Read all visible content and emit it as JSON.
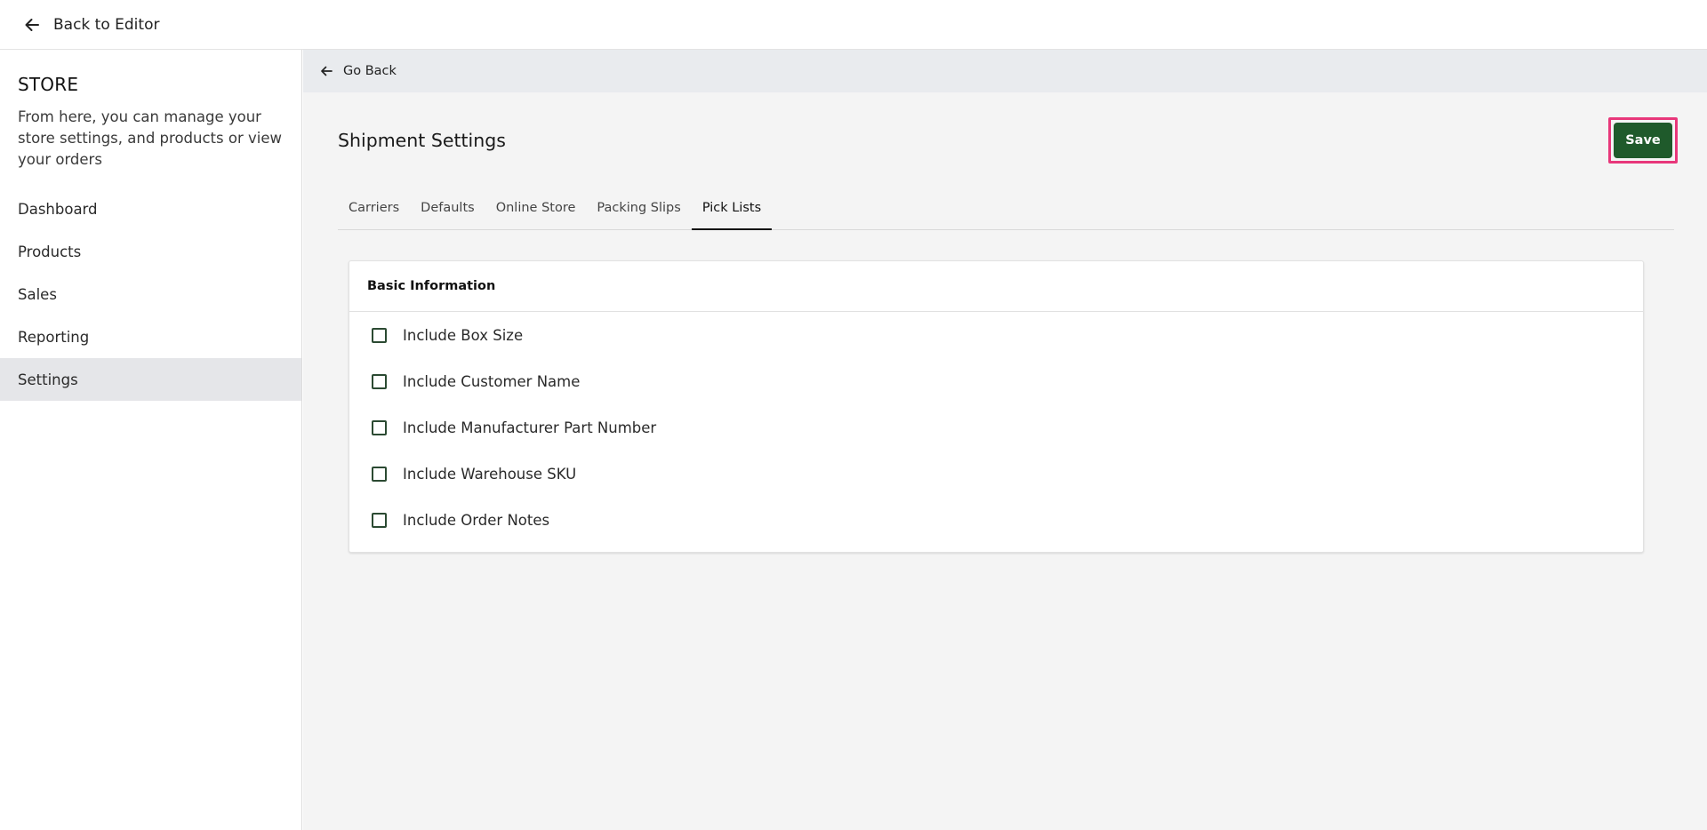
{
  "topbar": {
    "back_label": "Back to Editor"
  },
  "sidebar": {
    "title": "STORE",
    "description": "From here, you can manage your store settings, and products or view your orders",
    "items": [
      {
        "label": "Dashboard"
      },
      {
        "label": "Products"
      },
      {
        "label": "Sales"
      },
      {
        "label": "Reporting"
      },
      {
        "label": "Settings",
        "active": true
      }
    ]
  },
  "main": {
    "go_back_label": "Go Back",
    "page_title": "Shipment Settings",
    "save_label": "Save",
    "tabs": [
      {
        "label": "Carriers"
      },
      {
        "label": "Defaults"
      },
      {
        "label": "Online Store"
      },
      {
        "label": "Packing Slips"
      },
      {
        "label": "Pick Lists",
        "active": true
      }
    ],
    "card": {
      "title": "Basic Information",
      "options": [
        {
          "label": "Include Box Size",
          "checked": false
        },
        {
          "label": "Include Customer Name",
          "checked": false
        },
        {
          "label": "Include Manufacturer Part Number",
          "checked": false
        },
        {
          "label": "Include Warehouse SKU",
          "checked": false
        },
        {
          "label": "Include Order Notes",
          "checked": false
        }
      ]
    }
  },
  "colors": {
    "save_button": "#1f5a2b",
    "highlight_border": "#e8377a",
    "active_nav_bg": "#e5e6e9",
    "checkbox_border": "#2b4a32"
  },
  "icons": {
    "back_to_editor": "arrow-left-icon",
    "go_back": "arrow-left-icon"
  }
}
